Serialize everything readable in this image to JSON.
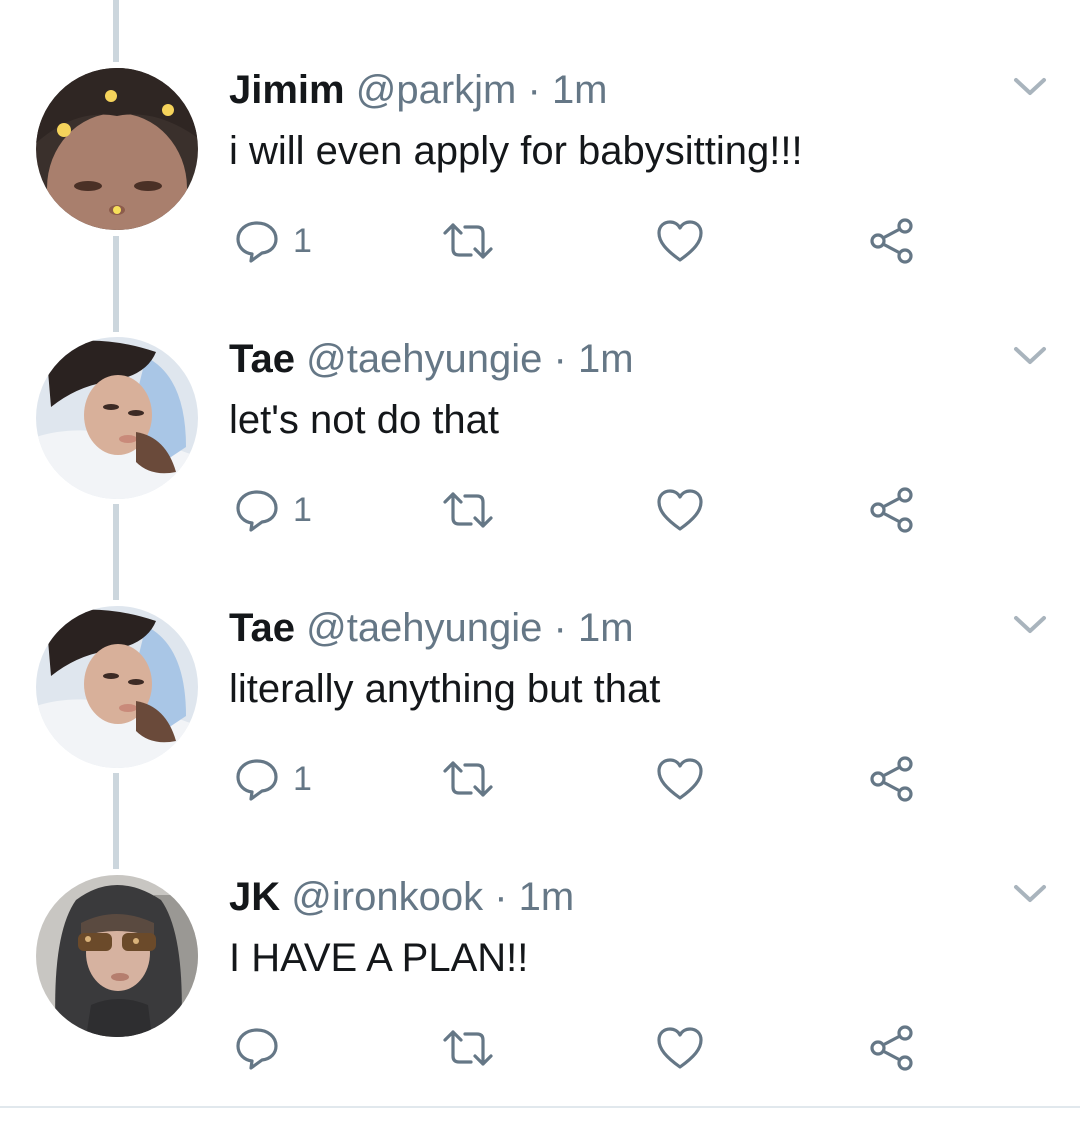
{
  "colors": {
    "text": "#14171a",
    "secondary": "#657786",
    "thread_line": "#ccd6dd",
    "divider": "#e1e8ed"
  },
  "tweets": [
    {
      "name": "Jimim",
      "handle": "@parkjm",
      "separator": "·",
      "time": "1m",
      "text": "i will even apply for babysitting!!!",
      "reply_count": "1"
    },
    {
      "name": "Tae",
      "handle": "@taehyungie",
      "separator": "·",
      "time": "1m",
      "text": "let's not do that",
      "reply_count": "1"
    },
    {
      "name": "Tae",
      "handle": "@taehyungie",
      "separator": "·",
      "time": "1m",
      "text": "literally anything but that",
      "reply_count": "1"
    },
    {
      "name": "JK",
      "handle": "@ironkook",
      "separator": "·",
      "time": "1m",
      "text": "I HAVE A PLAN!!",
      "reply_count": ""
    }
  ],
  "icons": {
    "reply": "reply-icon",
    "retweet": "retweet-icon",
    "like": "heart-icon",
    "share": "share-icon",
    "menu": "chevron-down-icon"
  }
}
